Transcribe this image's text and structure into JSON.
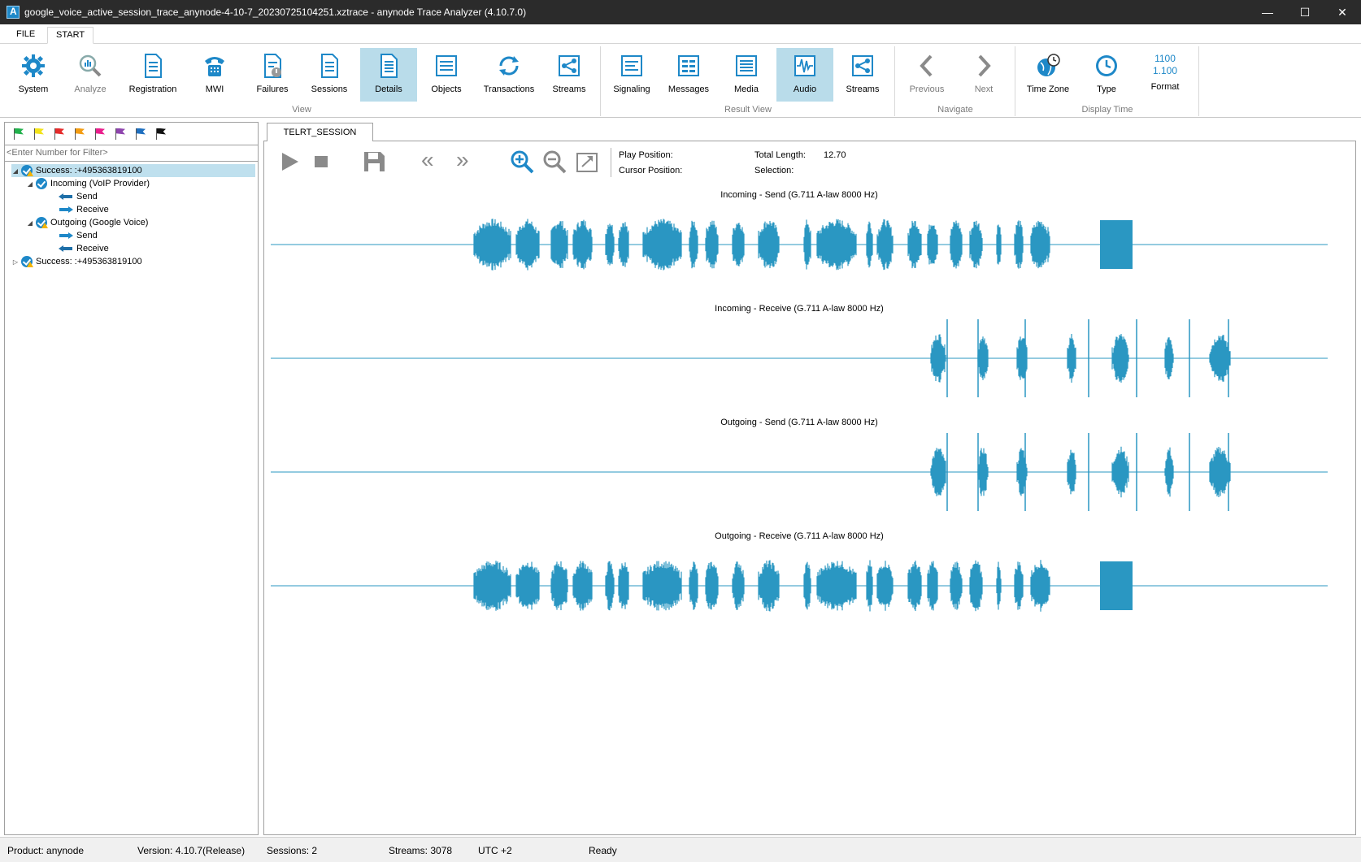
{
  "window": {
    "title": "google_voice_active_session_trace_anynode-4-10-7_20230725104251.xztrace - anynode Trace Analyzer (4.10.7.0)",
    "minimize": "—",
    "maximize": "☐",
    "close": "✕"
  },
  "menu": {
    "file": "FILE",
    "start": "START"
  },
  "ribbon": {
    "system": "System",
    "analyze": "Analyze",
    "registration": "Registration",
    "mwi": "MWI",
    "failures": "Failures",
    "sessions": "Sessions",
    "details": "Details",
    "objects": "Objects",
    "transactions": "Transactions",
    "streams_view": "Streams",
    "view_group": "View",
    "signaling": "Signaling",
    "messages": "Messages",
    "media": "Media",
    "audio": "Audio",
    "streams_result": "Streams",
    "result_group": "Result View",
    "previous": "Previous",
    "next": "Next",
    "navigate_group": "Navigate",
    "timezone": "Time Zone",
    "type": "Type",
    "format": "Format",
    "format_line1": "1100",
    "format_line2": "1.100",
    "display_group": "Display Time"
  },
  "left": {
    "filter_placeholder": "<Enter Number for Filter>",
    "flag_colors": [
      "#22b14c",
      "#f2e21a",
      "#e52b2b",
      "#f39c12",
      "#e91e8c",
      "#8e44ad",
      "#1e6fbf",
      "#111111"
    ],
    "tree": {
      "s1": "Success: :+495363819100",
      "incoming": "Incoming (VoIP Provider)",
      "in_send": "Send",
      "in_recv": "Receive",
      "outgoing": "Outgoing (Google Voice)",
      "out_send": "Send",
      "out_recv": "Receive",
      "s2": "Success: :+495363819100"
    }
  },
  "right": {
    "tab": "TELRT_SESSION",
    "play_position_label": "Play Position:",
    "cursor_position_label": "Cursor Position:",
    "total_length_label": "Total Length:",
    "total_length_value": "12.70",
    "selection_label": "Selection:",
    "waves": [
      {
        "title": "Incoming - Send (G.711 A-law 8000 Hz)"
      },
      {
        "title": "Incoming - Receive (G.711 A-law 8000 Hz)"
      },
      {
        "title": "Outgoing - Send (G.711 A-law 8000 Hz)"
      },
      {
        "title": "Outgoing - Receive (G.711 A-law 8000 Hz)"
      }
    ],
    "wave_color": "#2a97c2"
  },
  "status": {
    "product": "Product: anynode",
    "version": "Version: 4.10.7(Release)",
    "sessions": "Sessions: 2",
    "streams": "Streams: 3078",
    "utc": "UTC +2",
    "state": "Ready"
  }
}
